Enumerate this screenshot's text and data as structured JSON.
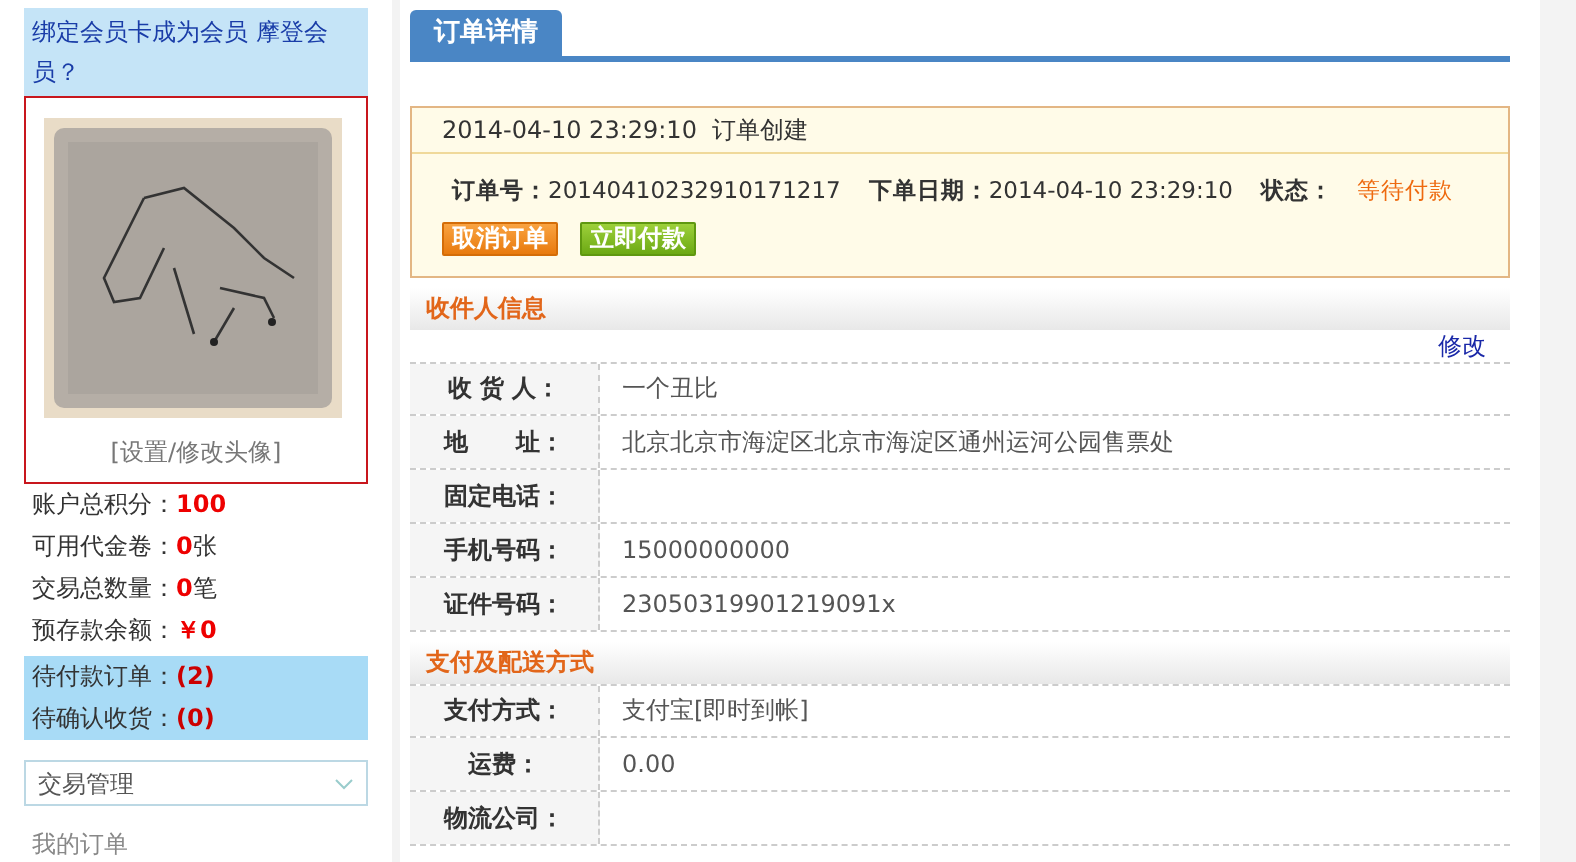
{
  "sidebar": {
    "member_link": "绑定会员卡成为会员  摩登会员？",
    "avatar": {
      "kind": "picture",
      "caption": "[设置/修改头像]"
    },
    "stats": [
      {
        "label": "账户总积分：",
        "value": "100"
      },
      {
        "label": "可用代金卷：",
        "value": "0",
        "unit": "张"
      },
      {
        "label": "交易总数量：",
        "value": "0",
        "unit": "笔"
      },
      {
        "label": "预存款余额：",
        "value": "￥0"
      }
    ],
    "pending": [
      {
        "label": "待付款订单：",
        "value": "(2)"
      },
      {
        "label": "待确认收货：",
        "value": "(0)"
      }
    ],
    "menu_select": {
      "value": "交易管理"
    },
    "menu_items": [
      "我的订单"
    ]
  },
  "main": {
    "tab": "订单详情",
    "order": {
      "created_time": "2014-04-10 23:29:10",
      "created_text": "订单创建",
      "number_label": "订单号：",
      "number": "20140410232910171217",
      "date_label": "下单日期：",
      "date": "2014-04-10 23:29:10",
      "status_label": "状态：",
      "status": "等待付款",
      "buttons": [
        {
          "label": "取消订单",
          "kind": "cancel"
        },
        {
          "label": "立即付款",
          "kind": "pay"
        }
      ]
    },
    "sections": [
      {
        "title": "收件人信息",
        "action": "修改",
        "rows": [
          {
            "label": "收 货 人：",
            "value": "一个丑比"
          },
          {
            "label": "地　　址：",
            "value": "北京北京市海淀区北京市海淀区通州运河公园售票处"
          },
          {
            "label": "固定电话："
          },
          {
            "label": "手机号码：",
            "value": "15000000000"
          },
          {
            "label": "证件号码：",
            "value": "23050319901219091x"
          }
        ]
      },
      {
        "title": "支付及配送方式",
        "rows": [
          {
            "label": "支付方式：",
            "value": "支付宝[即时到帐]"
          },
          {
            "label": "运费：",
            "value": "0.00"
          },
          {
            "label": "物流公司："
          }
        ]
      }
    ]
  }
}
